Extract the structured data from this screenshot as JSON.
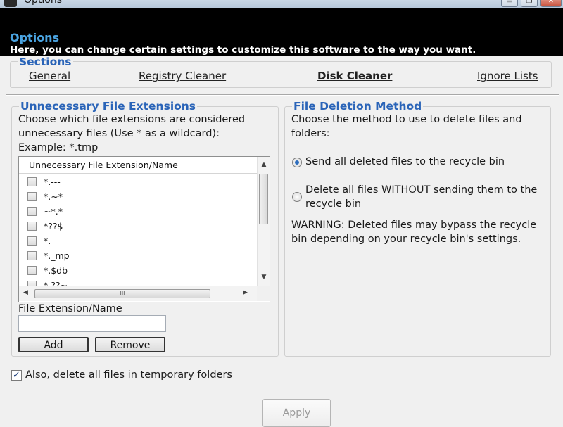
{
  "window": {
    "title": "Options"
  },
  "header": {
    "title": "Options",
    "subtitle": "Here, you can change certain settings to customize this software to the way you want."
  },
  "sections": {
    "legend": "Sections",
    "tabs": [
      {
        "label": "General"
      },
      {
        "label": "Registry Cleaner"
      },
      {
        "label": "Disk Cleaner",
        "active": true
      },
      {
        "label": "Ignore Lists"
      }
    ]
  },
  "extensions": {
    "legend": "Unnecessary File Extensions",
    "description_line1": "Choose which file extensions are considered",
    "description_line2": "unnecessary files (Use * as a wildcard):",
    "example": "Example: *.tmp",
    "list_header": "Unnecessary File Extension/Name",
    "items": [
      "*.---",
      "*.~*",
      "~*.*",
      "*??$",
      "*.___",
      "*._mp",
      "*.$db",
      "*.??~"
    ],
    "field_label": "File Extension/Name",
    "field_value": "",
    "add_label": "Add",
    "remove_label": "Remove"
  },
  "deletion": {
    "legend": "File Deletion Method",
    "description_line1": "Choose the method to use to delete files and",
    "description_line2": "folders:",
    "option1": "Send all deleted files to the recycle bin",
    "option2_line1": "Delete all files WITHOUT sending them to the",
    "option2_line2": "recycle bin",
    "warning_line1": "WARNING: Deleted files may bypass the recycle",
    "warning_line2": "bin depending on your recycle bin's settings."
  },
  "temp_folders": {
    "label": "Also, delete all files in temporary folders",
    "checked": true
  },
  "apply_label": "Apply",
  "icons": {
    "checkmark": "✓",
    "hscroll_grip": "III",
    "minimize": "▭",
    "restore": "❐",
    "close": "✕"
  }
}
